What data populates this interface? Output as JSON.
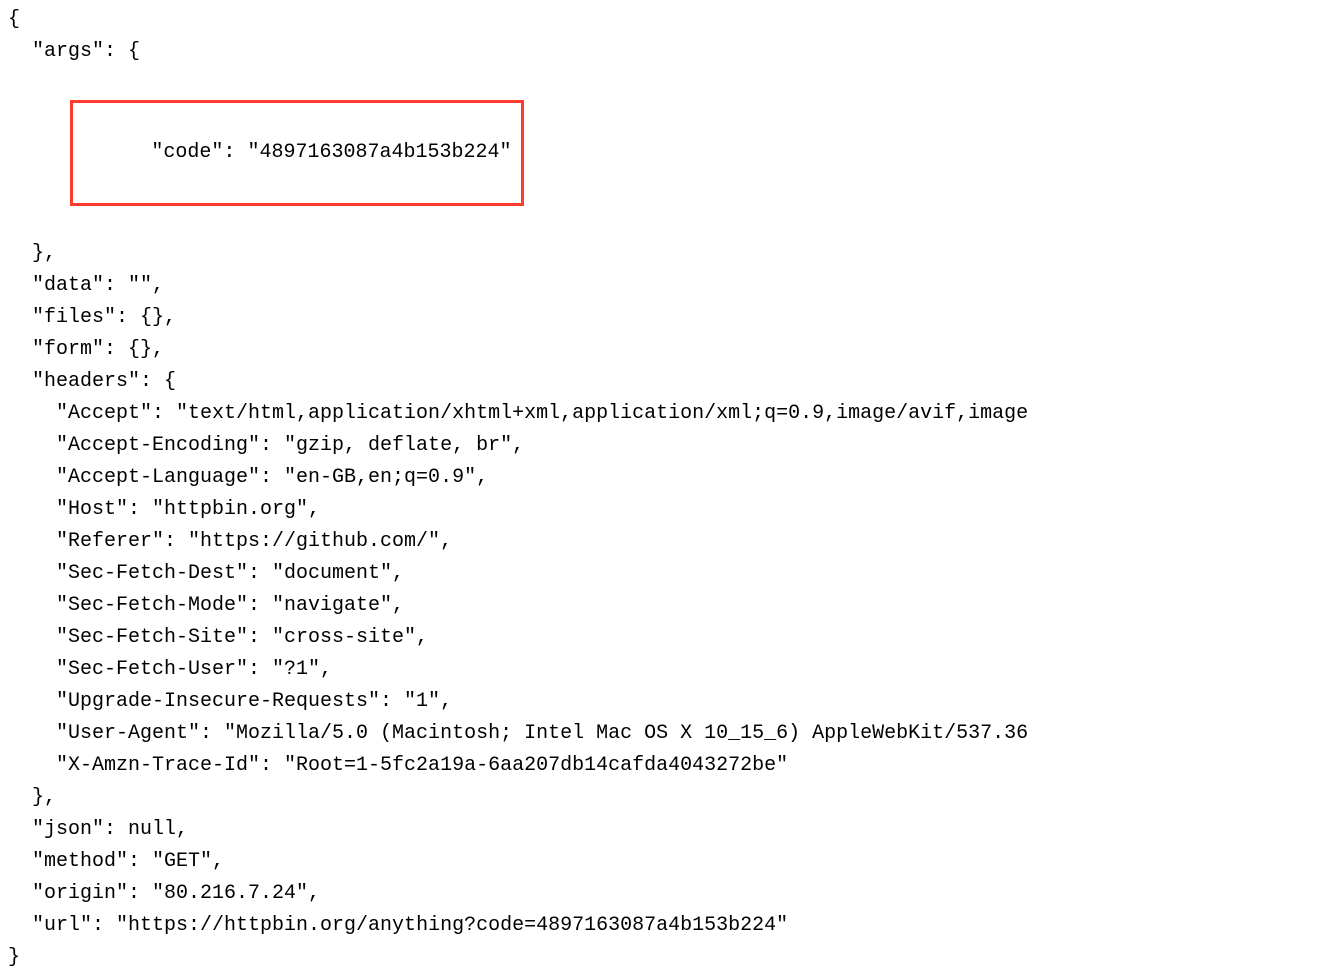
{
  "highlight_color": "#ff3b30",
  "json_response": {
    "args": {
      "code": "4897163087a4b153b224"
    },
    "data": "",
    "files": {},
    "form": {},
    "headers": {
      "Accept": "text/html,application/xhtml+xml,application/xml;q=0.9,image/avif,image",
      "Accept-Encoding": "gzip, deflate, br",
      "Accept-Language": "en-GB,en;q=0.9",
      "Host": "httpbin.org",
      "Referer": "https://github.com/",
      "Sec-Fetch-Dest": "document",
      "Sec-Fetch-Mode": "navigate",
      "Sec-Fetch-Site": "cross-site",
      "Sec-Fetch-User": "?1",
      "Upgrade-Insecure-Requests": "1",
      "User-Agent": "Mozilla/5.0 (Macintosh; Intel Mac OS X 10_15_6) AppleWebKit/537.36",
      "X-Amzn-Trace-Id": "Root=1-5fc2a19a-6aa207db14cafda4043272be"
    },
    "json": null,
    "method": "GET",
    "origin": "80.216.7.24",
    "url": "https://httpbin.org/anything?code=4897163087a4b153b224"
  },
  "rendered_lines": {
    "open": "{",
    "args_open": "\"args\": {",
    "args_code": "\"code\": \"4897163087a4b153b224\"",
    "args_close": "},",
    "data": "\"data\": \"\",",
    "files": "\"files\": {},",
    "form": "\"form\": {},",
    "headers_open": "\"headers\": {",
    "h_accept": "\"Accept\": \"text/html,application/xhtml+xml,application/xml;q=0.9,image/avif,image",
    "h_accept_encoding": "\"Accept-Encoding\": \"gzip, deflate, br\",",
    "h_accept_language": "\"Accept-Language\": \"en-GB,en;q=0.9\",",
    "h_host": "\"Host\": \"httpbin.org\",",
    "h_referer": "\"Referer\": \"https://github.com/\",",
    "h_sfd": "\"Sec-Fetch-Dest\": \"document\",",
    "h_sfm": "\"Sec-Fetch-Mode\": \"navigate\",",
    "h_sfs": "\"Sec-Fetch-Site\": \"cross-site\",",
    "h_sfu": "\"Sec-Fetch-User\": \"?1\",",
    "h_uir": "\"Upgrade-Insecure-Requests\": \"1\",",
    "h_ua": "\"User-Agent\": \"Mozilla/5.0 (Macintosh; Intel Mac OS X 10_15_6) AppleWebKit/537.36",
    "h_trace": "\"X-Amzn-Trace-Id\": \"Root=1-5fc2a19a-6aa207db14cafda4043272be\"",
    "headers_close": "},",
    "json": "\"json\": null,",
    "method": "\"method\": \"GET\",",
    "origin": "\"origin\": \"80.216.7.24\",",
    "url": "\"url\": \"https://httpbin.org/anything?code=4897163087a4b153b224\"",
    "close": "}"
  }
}
